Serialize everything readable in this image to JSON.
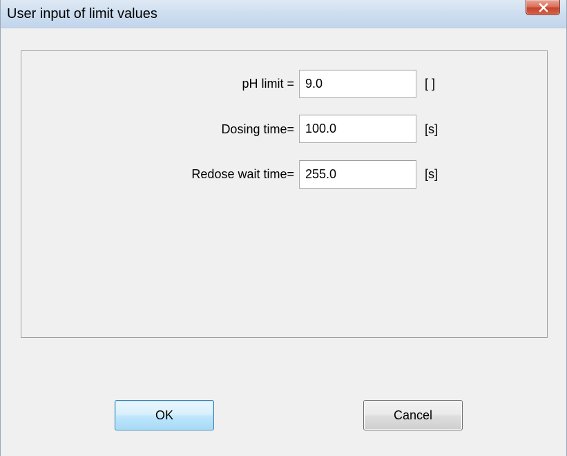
{
  "window": {
    "title": "User input of limit values"
  },
  "form": {
    "rows": [
      {
        "label": "pH limit =",
        "value": "9.0",
        "unit": "[ ]"
      },
      {
        "label": "Dosing time=",
        "value": "100.0",
        "unit": "[s]"
      },
      {
        "label": "Redose wait time=",
        "value": "255.0",
        "unit": "[s]"
      }
    ]
  },
  "buttons": {
    "ok_label": "OK",
    "cancel_label": "Cancel"
  },
  "colors": {
    "close_button": "#c4432b",
    "ok_button_border": "#3c7fb1",
    "dialog_background": "#f0f0f0"
  }
}
